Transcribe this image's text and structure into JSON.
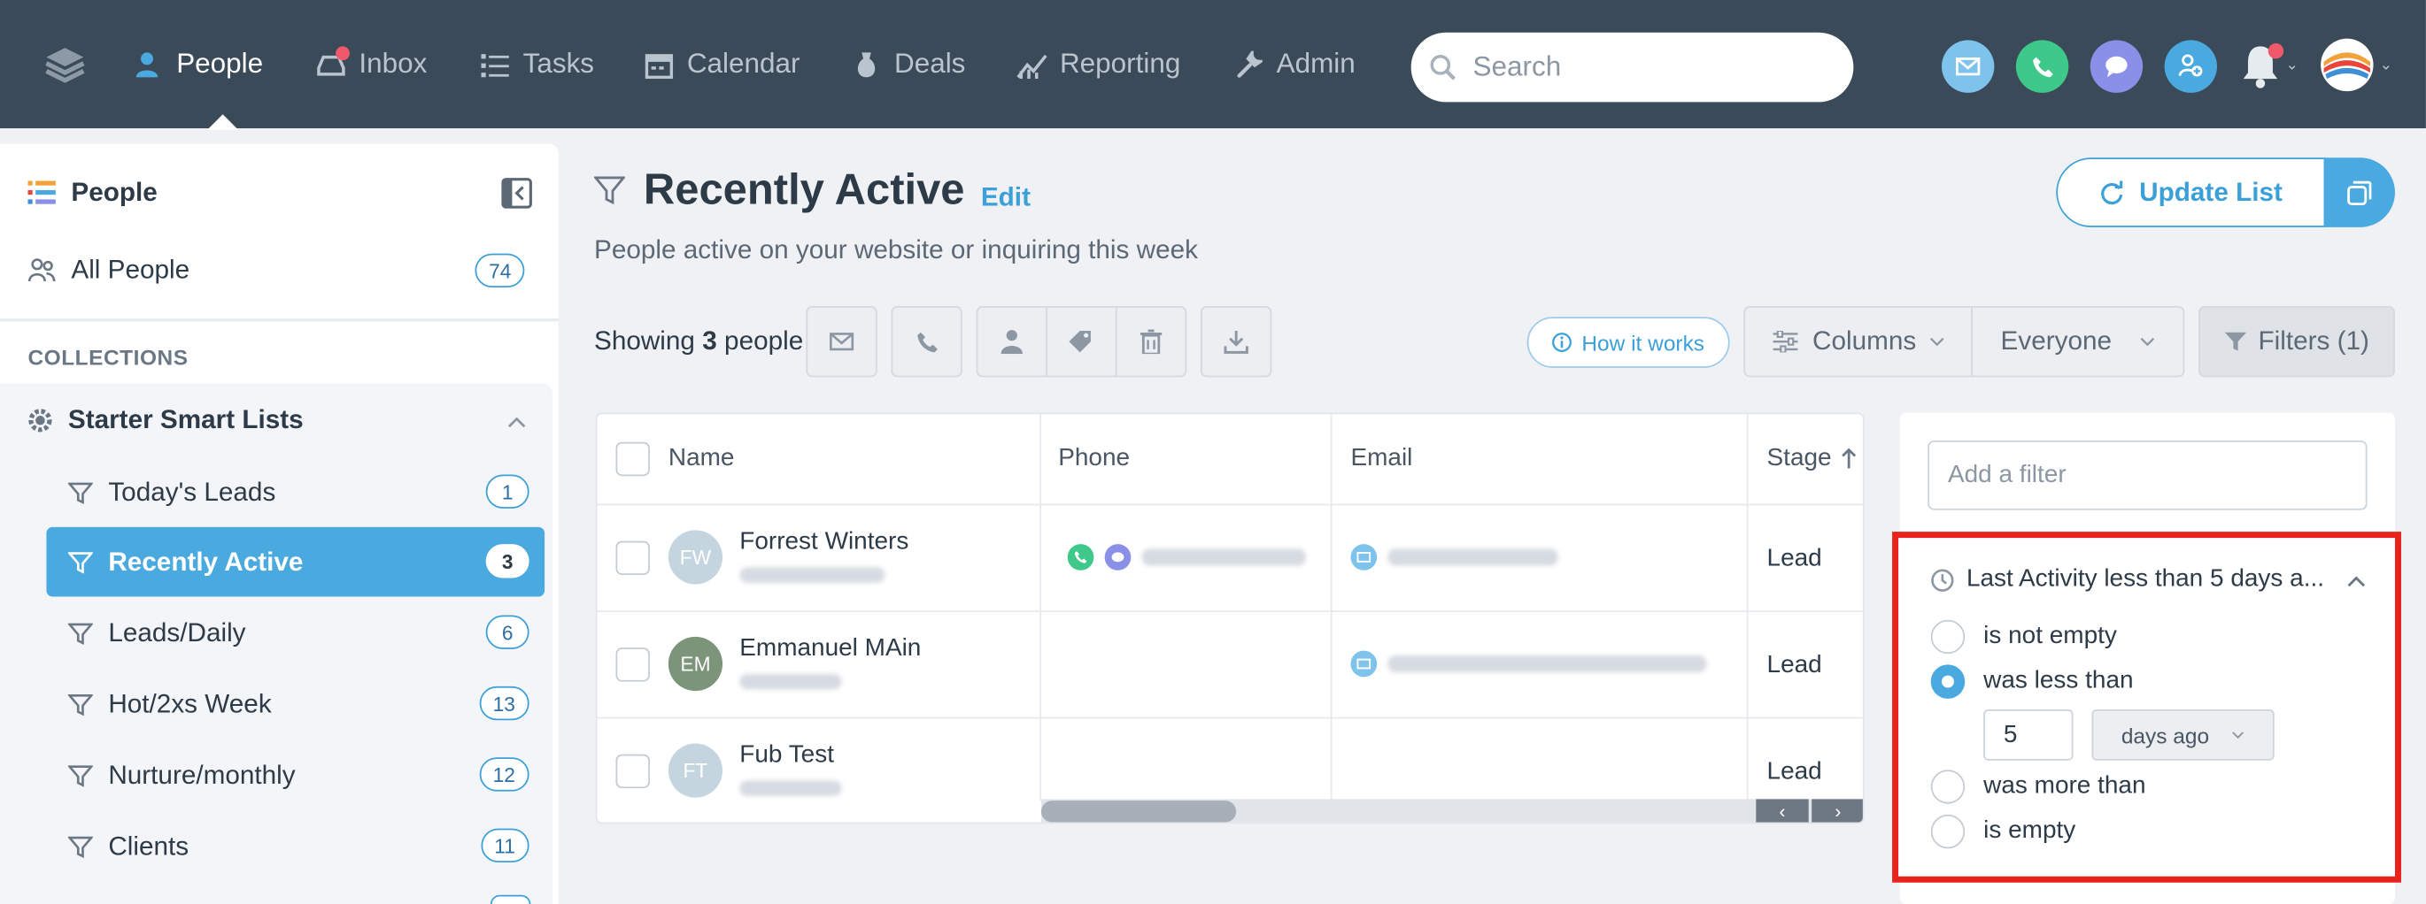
{
  "nav": {
    "items": [
      {
        "label": "People",
        "icon": "people-icon"
      },
      {
        "label": "Inbox",
        "icon": "inbox-icon"
      },
      {
        "label": "Tasks",
        "icon": "tasks-icon"
      },
      {
        "label": "Calendar",
        "icon": "calendar-icon"
      },
      {
        "label": "Deals",
        "icon": "deals-icon"
      },
      {
        "label": "Reporting",
        "icon": "reporting-icon"
      },
      {
        "label": "Admin",
        "icon": "admin-icon"
      }
    ],
    "active": "People",
    "search_placeholder": "Search"
  },
  "sidebar": {
    "title": "People",
    "all_people": {
      "label": "All People",
      "count": "74"
    },
    "collections_label": "COLLECTIONS",
    "group_title": "Starter Smart Lists",
    "items": [
      {
        "label": "Today's Leads",
        "count": "1"
      },
      {
        "label": "Recently Active",
        "count": "3"
      },
      {
        "label": "Leads/Daily",
        "count": "6"
      },
      {
        "label": "Hot/2xs Week",
        "count": "13"
      },
      {
        "label": "Nurture/monthly",
        "count": "12"
      },
      {
        "label": "Clients",
        "count": "11"
      }
    ],
    "active_item": "Recently Active"
  },
  "main": {
    "title": "Recently Active",
    "edit_label": "Edit",
    "subtitle": "People active on your website or inquiring this week",
    "update_label": "Update List",
    "showing_prefix": "Showing",
    "showing_count": "3",
    "showing_suffix": "people",
    "how_label": "How it works",
    "columns_label": "Columns",
    "everyone_label": "Everyone",
    "filters_label": "Filters (1)"
  },
  "table": {
    "headers": [
      "Name",
      "Phone",
      "Email",
      "Stage"
    ],
    "rows": [
      {
        "initials": "FW",
        "name": "Forrest Winters",
        "stage": "Lead",
        "avatar_color": "#c5d5df"
      },
      {
        "initials": "EM",
        "name": "Emmanuel MAin",
        "stage": "Lead",
        "avatar_color": "#7c9479"
      },
      {
        "initials": "FT",
        "name": "Fub Test",
        "stage": "Lead",
        "avatar_color": "#c5d5df"
      }
    ]
  },
  "filter": {
    "add_placeholder": "Add a filter",
    "title": "Last Activity less than 5 days a...",
    "options": [
      "is not empty",
      "was less than",
      "was more than",
      "is empty"
    ],
    "selected": "was less than",
    "value": "5",
    "unit": "days ago"
  },
  "colors": {
    "topbar": "#3b4a58",
    "accent": "#4aa9df",
    "highlight": "#e8231c"
  }
}
